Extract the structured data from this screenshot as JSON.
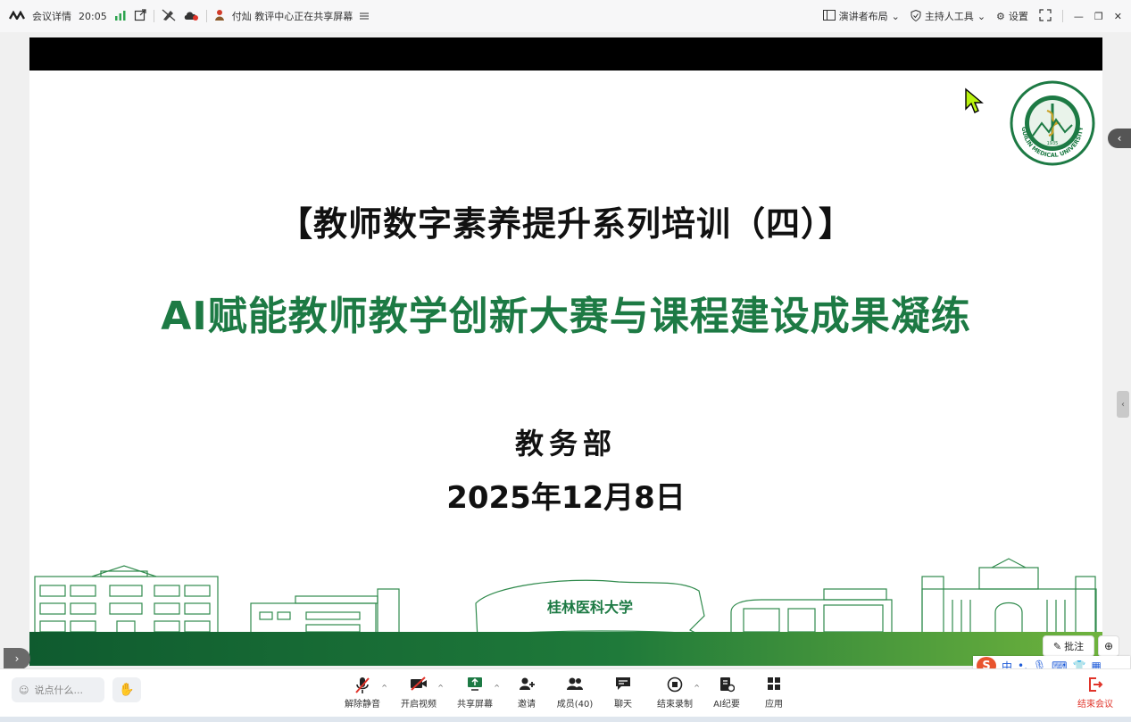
{
  "titlebar": {
    "meeting_details": "会议详情",
    "time": "20:05",
    "sharing_text": "付灿 教评中心正在共享屏幕",
    "presenter_layout": "演讲者布局",
    "host_tools": "主持人工具",
    "settings": "设置"
  },
  "slide": {
    "title": "【教师数字素养提升系列培训（四）】",
    "subtitle": "AI赋能教师教学创新大赛与课程建设成果凝练",
    "department": "教务部",
    "date": "2025年12月8日",
    "seal_center_year": "1935",
    "seal_text_outer": "GUILIN MEDICAL UNIVERSITY",
    "seal_text_top": "桂林医科大学",
    "building_sign": "桂林医科大学",
    "colors": {
      "title_green": "#1d7a44",
      "ground_dark": "#0f5b2f",
      "ground_light": "#6fb33d"
    }
  },
  "overlay": {
    "annotate": "批注",
    "ime_chinese": "中"
  },
  "toolbar": {
    "chat_placeholder": "说点什么...",
    "tools": [
      {
        "label": "解除静音",
        "icon": "mic-muted-icon"
      },
      {
        "label": "开启视频",
        "icon": "camera-off-icon"
      },
      {
        "label": "共享屏幕",
        "icon": "share-screen-icon"
      },
      {
        "label": "邀请",
        "icon": "invite-icon"
      },
      {
        "label": "成员(40)",
        "icon": "members-icon"
      },
      {
        "label": "聊天",
        "icon": "chat-icon"
      },
      {
        "label": "结束录制",
        "icon": "record-stop-icon"
      },
      {
        "label": "AI纪要",
        "icon": "ai-notes-icon"
      },
      {
        "label": "应用",
        "icon": "apps-icon"
      }
    ],
    "end_meeting": "结束会议"
  }
}
